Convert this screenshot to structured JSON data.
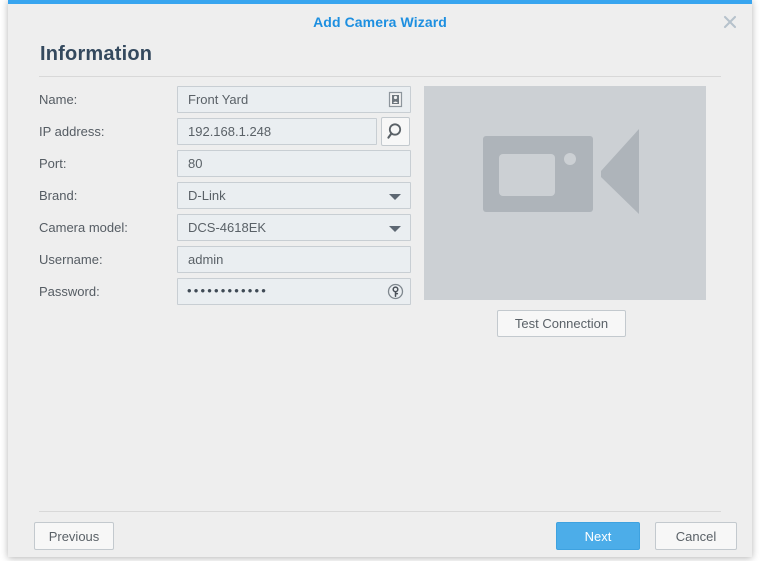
{
  "window": {
    "title": "Add Camera Wizard",
    "close_icon": "close-x-icon",
    "accent_color": "#38a5ef"
  },
  "page": {
    "heading": "Information"
  },
  "form": {
    "fields": [
      {
        "label": "Name:",
        "value": "Front Yard",
        "type": "text",
        "icon": "address-book-icon"
      },
      {
        "label": "IP address:",
        "value": "192.168.1.248",
        "type": "text",
        "icon": "search-icon"
      },
      {
        "label": "Port:",
        "value": "80",
        "type": "text",
        "icon": ""
      },
      {
        "label": "Brand:",
        "value": "D-Link",
        "type": "select",
        "icon": "chevron-down-icon"
      },
      {
        "label": "Camera model:",
        "value": "DCS-4618EK",
        "type": "select",
        "icon": "chevron-down-icon"
      },
      {
        "label": "Username:",
        "value": "admin",
        "type": "text",
        "icon": ""
      },
      {
        "label": "Password:",
        "value": "••••••••••••",
        "type": "password",
        "icon": "key-circle-icon"
      }
    ]
  },
  "preview": {
    "icon": "video-camera-icon",
    "background_color": "#ccd0d4",
    "test_connection_label": "Test Connection"
  },
  "footer": {
    "previous_label": "Previous",
    "next_label": "Next",
    "cancel_label": "Cancel",
    "next_color": "#4cade9"
  }
}
